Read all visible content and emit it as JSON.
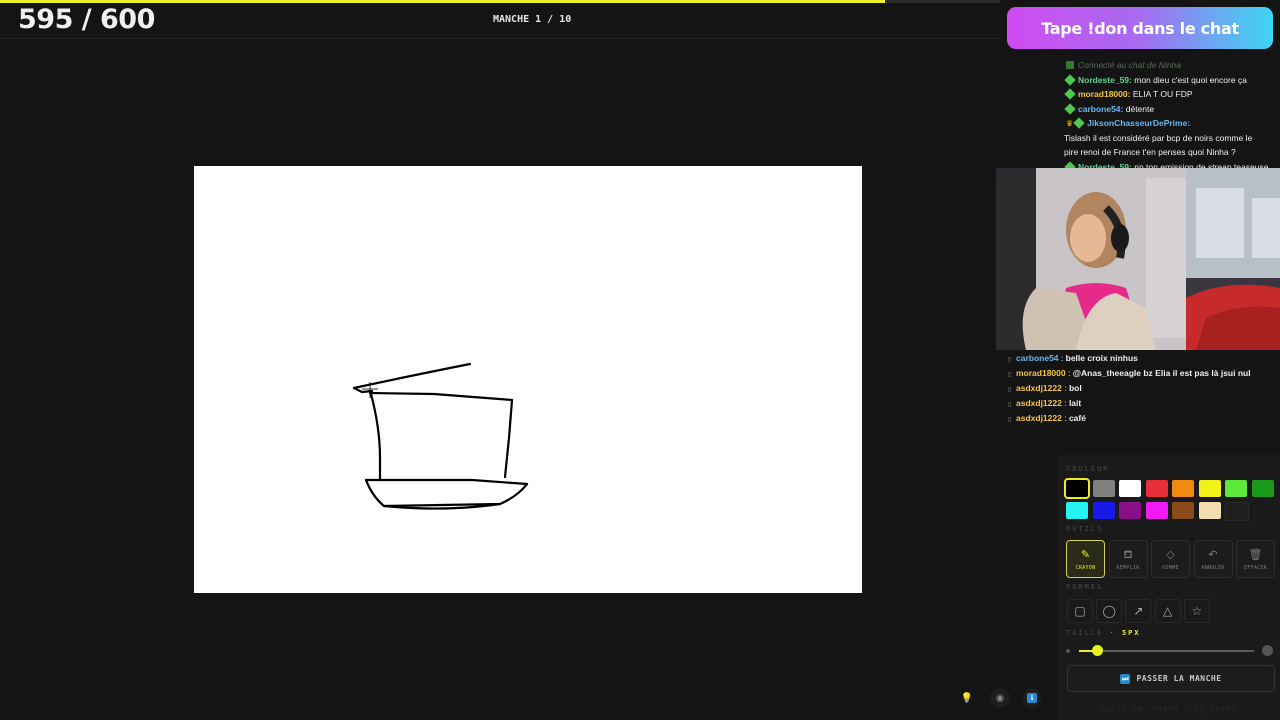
{
  "game": {
    "score": "595 / 600",
    "score_progress": 0.885,
    "round": "MANCHE 1 / 10"
  },
  "donation_banner": "Tape !don dans le chat",
  "chat_top": [
    {
      "user": "",
      "text": "Connecté au chat de Ninha",
      "system": true
    },
    {
      "user": "Nordeste_59:",
      "text": "mon dieu c'est quoi encore ça",
      "color": "#5fd38f"
    },
    {
      "user": "morad18000:",
      "text": "ELIA T OU FDP",
      "color": "#f5c542"
    },
    {
      "user": "carbone54:",
      "text": "détente",
      "color": "#6ab7f0"
    },
    {
      "user": "JiksonChasseurDePrime:",
      "text": "",
      "color": "#6ab7f0",
      "crown": true
    },
    {
      "user": "",
      "text": "Tislash il est considéré par bcp de noirs comme le"
    },
    {
      "user": "",
      "text": "pire renoi de France t'en penses quoi Ninha ?"
    },
    {
      "user": "Nordeste_59:",
      "text": "nn ton emission de streap teaseuse",
      "color": "#5fd38f"
    }
  ],
  "chat_bottom": [
    {
      "user": "carbone54",
      "text": "belle croix ninhus",
      "color": "#6ab7f0"
    },
    {
      "user": "morad18000",
      "text": "@Anas_theeagle bz Elia il est pas là jsui nul",
      "color": "#f5c542"
    },
    {
      "user": "asdxdj1222",
      "text": "bol",
      "color": "#f5c542"
    },
    {
      "user": "asdxdj1222",
      "text": "lait",
      "color": "#f5c542"
    },
    {
      "user": "asdxdj1222",
      "text": "café",
      "color": "#f5c542"
    }
  ],
  "palette": {
    "label": "COULEUR",
    "colors": [
      "#000000",
      "#808080",
      "#ffffff",
      "#e8303a",
      "#f08a10",
      "#f2f21a",
      "#5ee83a",
      "#1a9a1a",
      "#25f2f2",
      "#1a1ae8",
      "#8a108a",
      "#f21af2",
      "#8a4a1a",
      "#f2ddb0"
    ],
    "selected": 0
  },
  "tools": {
    "label": "OUTILS",
    "items": [
      {
        "id": "crayon",
        "label": "CRAYON",
        "icon": "pencil-icon",
        "active": true
      },
      {
        "id": "remplir",
        "label": "REMPLIR",
        "icon": "fill-icon"
      },
      {
        "id": "gomme",
        "label": "GOMME",
        "icon": "eraser-icon"
      },
      {
        "id": "annuler",
        "label": "ANNULER",
        "icon": "undo-icon"
      },
      {
        "id": "effacer",
        "label": "EFFACER",
        "icon": "trash-icon"
      }
    ]
  },
  "shapes": {
    "label": "FORMES",
    "items": [
      "rectangle-icon",
      "ellipse-icon",
      "arrow-icon",
      "triangle-icon",
      "star-icon"
    ]
  },
  "size": {
    "label": "TAILLE",
    "value": "5PX",
    "level": 0.1
  },
  "next_round_label": "PASSER LA MANCHE",
  "footer": "built for ninha · by saidu"
}
